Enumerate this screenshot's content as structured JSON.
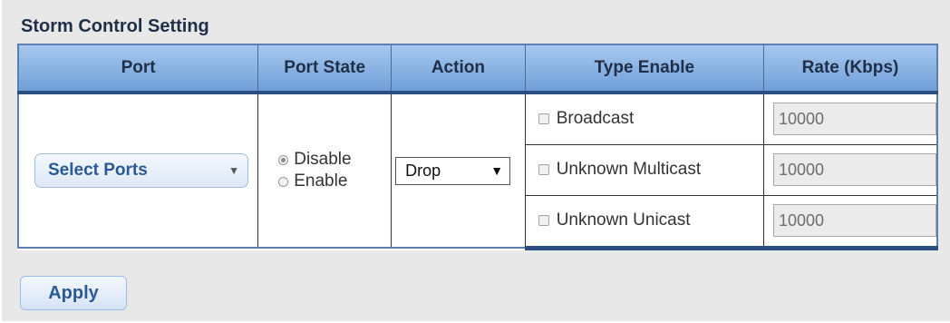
{
  "title": "Storm Control Setting",
  "columns": [
    "Port",
    "Port State",
    "Action",
    "Type Enable",
    "Rate (Kbps)"
  ],
  "port_select": {
    "label": "Select Ports",
    "icon": "chevron-down-icon"
  },
  "port_state": {
    "options": [
      {
        "label": "Disable",
        "checked": true
      },
      {
        "label": "Enable",
        "checked": false
      }
    ]
  },
  "action": {
    "selected": "Drop",
    "icon": "dropdown-arrow-icon"
  },
  "types": [
    {
      "label": "Broadcast",
      "checked": false,
      "rate": "10000"
    },
    {
      "label": "Unknown Multicast",
      "checked": false,
      "rate": "10000"
    },
    {
      "label": "Unknown Unicast",
      "checked": false,
      "rate": "10000"
    }
  ],
  "apply_label": "Apply"
}
